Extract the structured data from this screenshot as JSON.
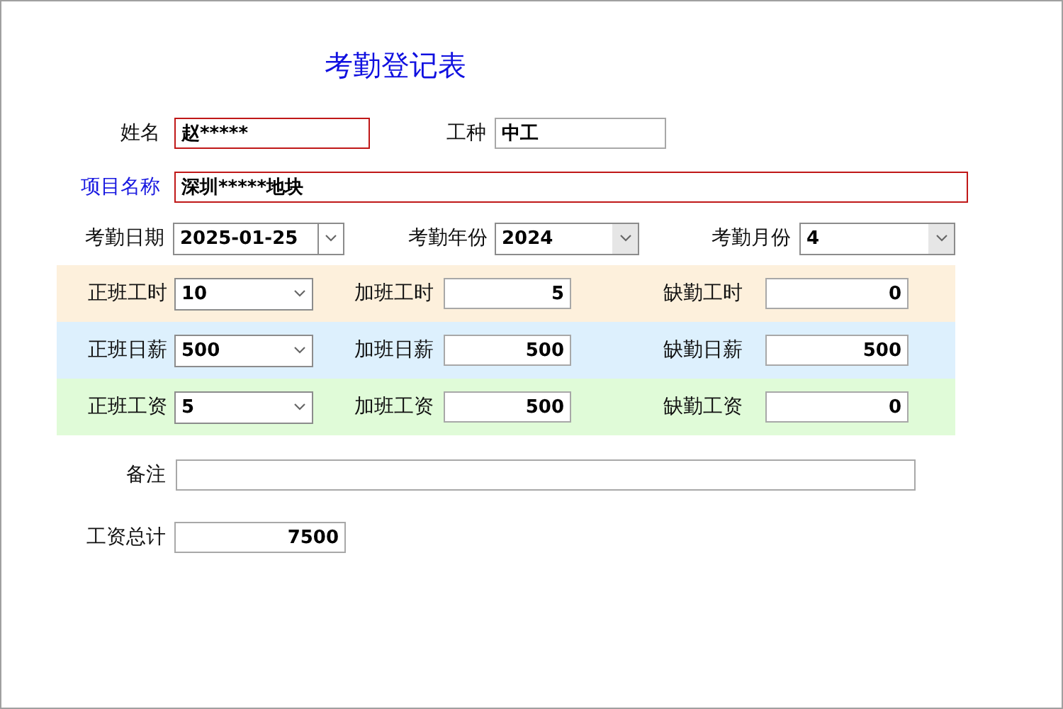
{
  "title": "考勤登记表",
  "top_rows": [
    [
      {
        "label": "姓名",
        "value": "赵*****",
        "kind": "text",
        "required": true,
        "emphasis": false
      },
      {
        "label": "工种",
        "value": "中工",
        "kind": "text",
        "required": false,
        "emphasis": false
      }
    ],
    [
      {
        "label": "项目名称",
        "value": "深圳*****地块",
        "kind": "text",
        "required": true,
        "emphasis": true
      }
    ],
    [
      {
        "label": "考勤日期",
        "value": "2025-01-25",
        "kind": "date",
        "required": false,
        "emphasis": false
      },
      {
        "label": "考勤年份",
        "value": "2024",
        "kind": "select",
        "required": false,
        "emphasis": false
      },
      {
        "label": "考勤月份",
        "value": "4",
        "kind": "select",
        "required": false,
        "emphasis": false
      }
    ]
  ],
  "bands": [
    {
      "color": "#fdf0dc",
      "fields": [
        {
          "label": "正班工时",
          "value": "10",
          "kind": "select"
        },
        {
          "label": "加班工时",
          "value": "5",
          "kind": "number"
        },
        {
          "label": "缺勤工时",
          "value": "0",
          "kind": "number"
        }
      ]
    },
    {
      "color": "#ddf0fd",
      "fields": [
        {
          "label": "正班日薪",
          "value": "500",
          "kind": "select"
        },
        {
          "label": "加班日薪",
          "value": "500",
          "kind": "number"
        },
        {
          "label": "缺勤日薪",
          "value": "500",
          "kind": "number"
        }
      ]
    },
    {
      "color": "#e0fbd8",
      "fields": [
        {
          "label": "正班工资",
          "value": "5",
          "kind": "select"
        },
        {
          "label": "加班工资",
          "value": "500",
          "kind": "number"
        },
        {
          "label": "缺勤工资",
          "value": "0",
          "kind": "number"
        }
      ]
    }
  ],
  "remark": {
    "label": "备注",
    "kind": "text"
  },
  "total": {
    "label": "工资总计",
    "value": "7500",
    "kind": "number"
  }
}
